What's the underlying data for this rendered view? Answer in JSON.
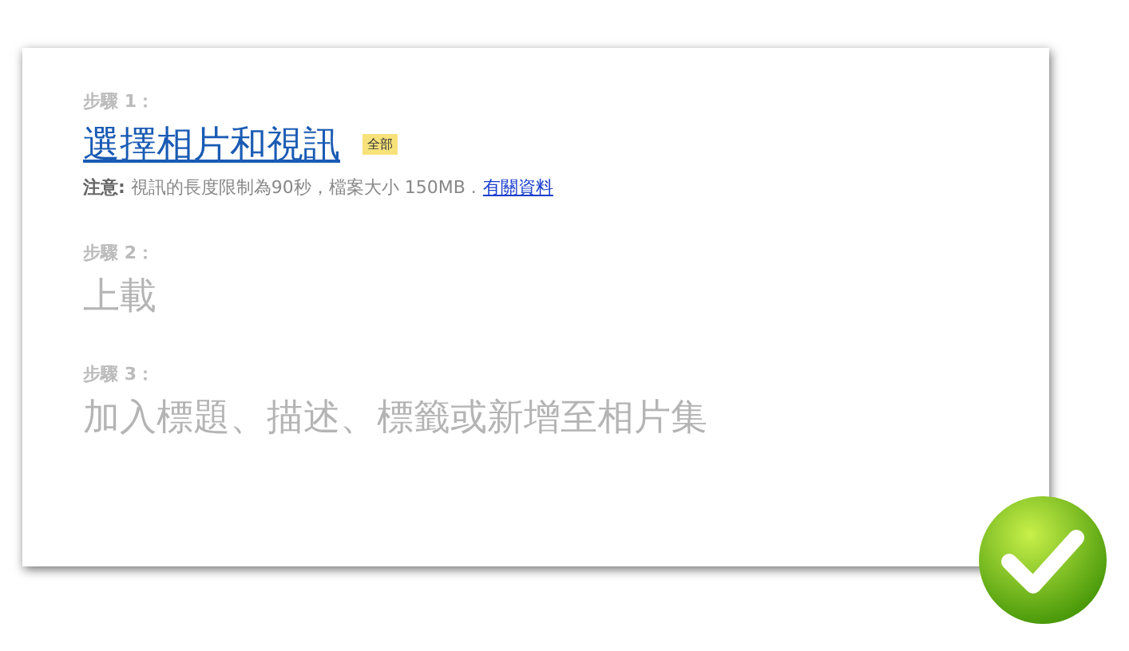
{
  "steps": [
    {
      "label": "步驟 1：",
      "title": "選擇相片和視訊",
      "active": true,
      "badge": "全部",
      "note": "**注意:** 視訊的長度限制為90秒，檔案大小  150MB .",
      "note_link": "有關資料"
    },
    {
      "label": "步驟 2：",
      "title": "上載",
      "active": false
    },
    {
      "label": "步驟 3：",
      "title": "加入標題、描述、標籤或新增至相片集",
      "active": false
    }
  ],
  "done": true
}
